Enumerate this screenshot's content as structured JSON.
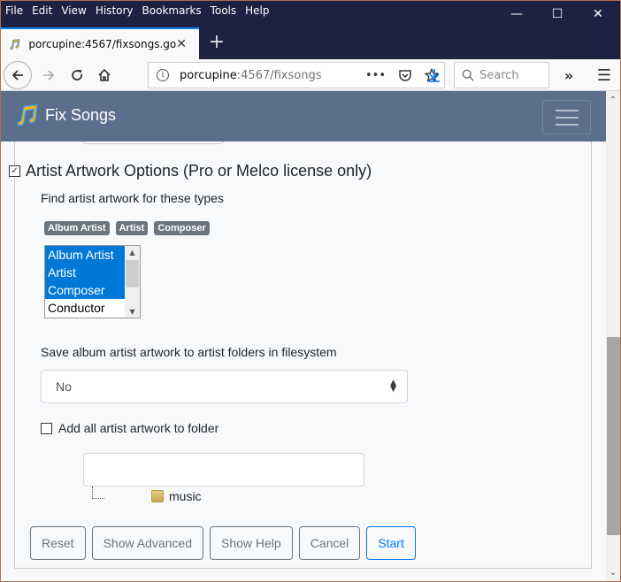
{
  "browser": {
    "menu": [
      "File",
      "Edit",
      "View",
      "History",
      "Bookmarks",
      "Tools",
      "Help"
    ],
    "menu_accels": [
      "F",
      "E",
      "V",
      "s",
      "B",
      "T",
      "H"
    ],
    "tab": {
      "title": "porcupine:4567/fixsongs.go",
      "favicon": "music-note-icon"
    },
    "url": {
      "host": "porcupine",
      "rest": ":4567/fixsongs."
    },
    "search_placeholder": "Search",
    "window_controls": {
      "minimize": "—",
      "maximize": "☐",
      "close": "✕"
    }
  },
  "app": {
    "brand": "Fix Songs"
  },
  "artist_artwork": {
    "checked": true,
    "title": "Artist Artwork Options (Pro or Melco license only)",
    "find_label": "Find artist artwork for these types",
    "selected_badges": [
      "Album Artist",
      "Artist",
      "Composer"
    ],
    "type_options": [
      {
        "label": "Album Artist",
        "selected": true
      },
      {
        "label": "Artist",
        "selected": true
      },
      {
        "label": "Composer",
        "selected": true
      },
      {
        "label": "Conductor",
        "selected": false
      }
    ],
    "save_label": "Save album artist artwork to artist folders in filesystem",
    "save_value": "No",
    "add_all_label": "Add all artist artwork to folder",
    "add_all_checked": false,
    "folder_value": "",
    "tree_root": "music"
  },
  "buttons": {
    "reset": "Reset",
    "show_advanced": "Show Advanced",
    "show_help": "Show Help",
    "cancel": "Cancel",
    "start": "Start"
  }
}
